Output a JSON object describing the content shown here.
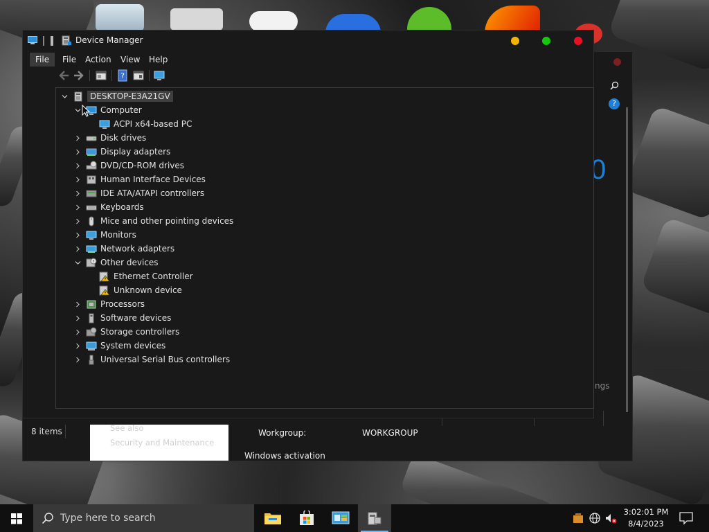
{
  "window": {
    "title": "Device Manager",
    "menu": [
      "File",
      "Action",
      "View",
      "Help"
    ]
  },
  "tree": {
    "root": "DESKTOP-E3A21GV",
    "categories": [
      {
        "label": "Computer",
        "expanded": true,
        "icon": "computer-icon",
        "children": [
          {
            "label": "ACPI x64-based PC",
            "icon": "monitor-icon"
          }
        ]
      },
      {
        "label": "Disk drives",
        "expanded": false,
        "icon": "disk-drive-icon"
      },
      {
        "label": "Display adapters",
        "expanded": false,
        "icon": "display-adapter-icon"
      },
      {
        "label": "DVD/CD-ROM drives",
        "expanded": false,
        "icon": "dvd-drive-icon"
      },
      {
        "label": "Human Interface Devices",
        "expanded": false,
        "icon": "hid-icon"
      },
      {
        "label": "IDE ATA/ATAPI controllers",
        "expanded": false,
        "icon": "ide-controller-icon"
      },
      {
        "label": "Keyboards",
        "expanded": false,
        "icon": "keyboard-icon"
      },
      {
        "label": "Mice and other pointing devices",
        "expanded": false,
        "icon": "mouse-icon"
      },
      {
        "label": "Monitors",
        "expanded": false,
        "icon": "monitor-icon"
      },
      {
        "label": "Network adapters",
        "expanded": false,
        "icon": "network-adapter-icon"
      },
      {
        "label": "Other devices",
        "expanded": true,
        "icon": "other-devices-icon",
        "children": [
          {
            "label": "Ethernet Controller",
            "icon": "warning-device-icon"
          },
          {
            "label": "Unknown device",
            "icon": "warning-device-icon"
          }
        ]
      },
      {
        "label": "Processors",
        "expanded": false,
        "icon": "processor-icon"
      },
      {
        "label": "Software devices",
        "expanded": false,
        "icon": "software-device-icon"
      },
      {
        "label": "Storage controllers",
        "expanded": false,
        "icon": "storage-controller-icon"
      },
      {
        "label": "System devices",
        "expanded": false,
        "icon": "system-device-icon"
      },
      {
        "label": "Universal Serial Bus controllers",
        "expanded": false,
        "icon": "usb-icon"
      }
    ]
  },
  "background_window": {
    "status": "8 items",
    "see_also": "See also",
    "security_link": "Security and Maintenance",
    "workgroup_label": "Workgroup:",
    "workgroup_value": "WORKGROUP",
    "windows_activation": "Windows activation",
    "settings_fragment": "ngs",
    "big_text_fragment": "0"
  },
  "taskbar": {
    "search_placeholder": "Type here to search",
    "time": "3:02:01 PM",
    "date": "8/4/2023",
    "apps": [
      "file-explorer-icon",
      "microsoft-store-icon",
      "control-panel-icon",
      "device-manager-icon"
    ]
  },
  "colors": {
    "close": "#e81123",
    "minimize": "#f5b400",
    "maximize": "#16c60c",
    "accent": "#1e7fd6",
    "window_bg": "#191919"
  }
}
